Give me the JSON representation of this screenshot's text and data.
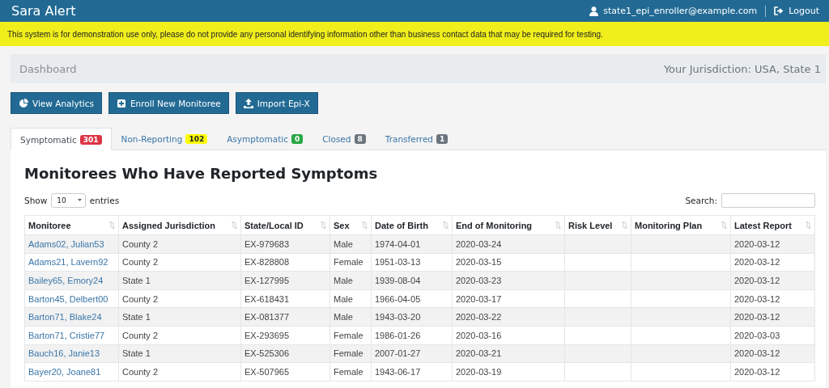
{
  "navbar": {
    "brand": "Sara Alert",
    "user": "state1_epi_enroller@example.com",
    "logout": "Logout"
  },
  "notice": "This system is for demonstration use only, please do not provide any personal identifying information other than business contact data that may be required for testing.",
  "breadcrumb": {
    "title": "Dashboard",
    "jurisdiction": "Your Jurisdiction: USA, State 1"
  },
  "actions": [
    {
      "label": "View Analytics",
      "kind": "analytics"
    },
    {
      "label": "Enroll New Monitoree",
      "kind": "enroll"
    },
    {
      "label": "Import Epi-X",
      "kind": "import"
    }
  ],
  "tabs": [
    {
      "label": "Symptomatic",
      "count": "301",
      "color": "#dc3545",
      "selected": true
    },
    {
      "label": "Non-Reporting",
      "count": "102",
      "color": "#ffff00",
      "selected": false
    },
    {
      "label": "Asymptomatic",
      "count": "0",
      "color": "#28a745",
      "selected": false
    },
    {
      "label": "Closed",
      "count": "8",
      "color": "#6c757d",
      "selected": false
    },
    {
      "label": "Transferred",
      "count": "1",
      "color": "#6c757d",
      "selected": false
    }
  ],
  "panel_title": "Monitorees Who Have Reported Symptoms",
  "length_menu": {
    "before": "Show",
    "value": "10",
    "after": "entries"
  },
  "search": {
    "label": "Search:"
  },
  "table": {
    "columns": [
      "Monitoree",
      "Assigned Jurisdiction",
      "State/Local ID",
      "Sex",
      "Date of Birth",
      "End of Monitoring",
      "Risk Level",
      "Monitoring Plan",
      "Latest Report"
    ],
    "rows": [
      {
        "monitoree": "Adams02, Julian53",
        "assigned_jurisdiction": "County 2",
        "state_local_id": "EX-979683",
        "sex": "Male",
        "date_of_birth": "1974-04-01",
        "end_of_monitoring": "2020-03-24",
        "latest_report": "2020-03-12"
      },
      {
        "monitoree": "Adams21, Lavern92",
        "assigned_jurisdiction": "County 2",
        "state_local_id": "EX-828808",
        "sex": "Female",
        "date_of_birth": "1951-03-13",
        "end_of_monitoring": "2020-03-15",
        "latest_report": "2020-03-12"
      },
      {
        "monitoree": "Bailey65, Emory24",
        "assigned_jurisdiction": "State 1",
        "state_local_id": "EX-127995",
        "sex": "Male",
        "date_of_birth": "1939-08-04",
        "end_of_monitoring": "2020-03-23",
        "latest_report": "2020-03-12"
      },
      {
        "monitoree": "Barton45, Delbert00",
        "assigned_jurisdiction": "County 2",
        "state_local_id": "EX-618431",
        "sex": "Male",
        "date_of_birth": "1966-04-05",
        "end_of_monitoring": "2020-03-17",
        "latest_report": "2020-03-12"
      },
      {
        "monitoree": "Barton71, Blake24",
        "assigned_jurisdiction": "State 1",
        "state_local_id": "EX-081377",
        "sex": "Male",
        "date_of_birth": "1943-03-20",
        "end_of_monitoring": "2020-03-22",
        "latest_report": "2020-03-12"
      },
      {
        "monitoree": "Barton71, Cristie77",
        "assigned_jurisdiction": "County 2",
        "state_local_id": "EX-293695",
        "sex": "Female",
        "date_of_birth": "1986-01-26",
        "end_of_monitoring": "2020-03-16",
        "latest_report": "2020-03-03"
      },
      {
        "monitoree": "Bauch16, Janie13",
        "assigned_jurisdiction": "State 1",
        "state_local_id": "EX-525306",
        "sex": "Female",
        "date_of_birth": "2007-01-27",
        "end_of_monitoring": "2020-03-21",
        "latest_report": "2020-03-12"
      },
      {
        "monitoree": "Bayer20, Joane81",
        "assigned_jurisdiction": "County 2",
        "state_local_id": "EX-507965",
        "sex": "Female",
        "date_of_birth": "1943-06-17",
        "end_of_monitoring": "2020-03-19",
        "latest_report": "2020-03-12"
      }
    ]
  }
}
